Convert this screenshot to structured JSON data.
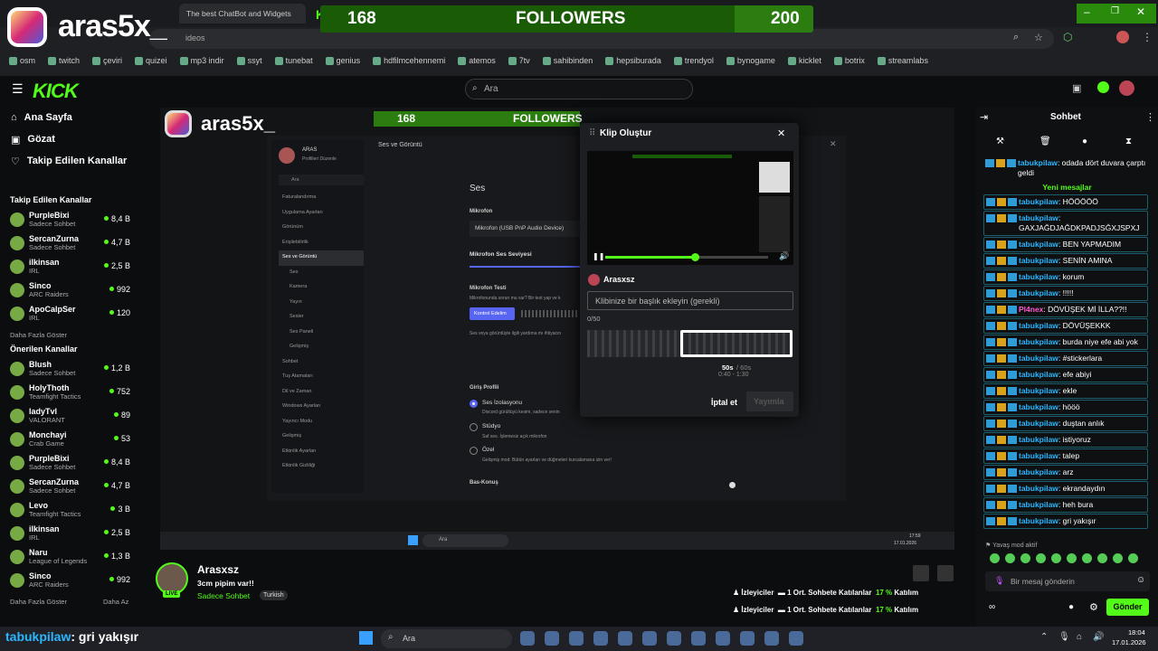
{
  "overlay": {
    "streamer_name": "aras5x_",
    "followers_current": "168",
    "followers_label": "FOLLOWERS",
    "followers_goal": "200",
    "follower_progress": 0.84
  },
  "browser": {
    "tab_title": "The best ChatBot and Widgets",
    "url_fragment": "ideos",
    "bookmarks": [
      "osm",
      "twitch",
      "çeviri",
      "quizei",
      "mp3 indir",
      "ssyt",
      "tunebat",
      "genius",
      "hdfilmcehennemi",
      "atemos",
      "7tv",
      "sahibinden",
      "hepsiburada",
      "trendyol",
      "bynogame",
      "kicklet",
      "botrix",
      "streamlabs"
    ]
  },
  "kick": {
    "logo": "KICK",
    "search_placeholder": "Ara"
  },
  "sidebar": {
    "nav": [
      {
        "label": "Ana Sayfa",
        "icon": "home-icon"
      },
      {
        "label": "Gözat",
        "icon": "browse-icon"
      },
      {
        "label": "Takip Edilen Kanallar",
        "icon": "heart-icon"
      }
    ],
    "followed_title": "Takip Edilen Kanallar",
    "followed": [
      {
        "name": "PurpleBixi",
        "cat": "Sadece Sohbet",
        "viewers": "8,4 B"
      },
      {
        "name": "SercanZurna",
        "cat": "Sadece Sohbet",
        "viewers": "4,7 B"
      },
      {
        "name": "ilkinsan",
        "cat": "IRL",
        "viewers": "2,5 B"
      },
      {
        "name": "Sinco",
        "cat": "ARC Raiders",
        "viewers": "992"
      },
      {
        "name": "ApoCalpSer",
        "cat": "IRL",
        "viewers": "120"
      }
    ],
    "followed_more": "Daha Fazla Göster",
    "recommended_title": "Önerilen Kanallar",
    "recommended": [
      {
        "name": "Blush",
        "cat": "Sadece Sohbet",
        "viewers": "1,2 B"
      },
      {
        "name": "HolyThoth",
        "cat": "Teamfight Tactics",
        "viewers": "752"
      },
      {
        "name": "ladyTvl",
        "cat": "VALORANT",
        "viewers": "89"
      },
      {
        "name": "Monchayi",
        "cat": "Crab Game",
        "viewers": "53"
      },
      {
        "name": "PurpleBixi",
        "cat": "Sadece Sohbet",
        "viewers": "8,4 B"
      },
      {
        "name": "SercanZurna",
        "cat": "Sadece Sohbet",
        "viewers": "4,7 B"
      },
      {
        "name": "Levo",
        "cat": "Teamfight Tactics",
        "viewers": "3 B"
      },
      {
        "name": "ilkinsan",
        "cat": "IRL",
        "viewers": "2,5 B"
      },
      {
        "name": "Naru",
        "cat": "League of Legends",
        "viewers": "1,3 B"
      },
      {
        "name": "Sinco",
        "cat": "ARC Raiders",
        "viewers": "992"
      }
    ],
    "rec_more": "Daha Fazla Göster",
    "rec_less": "Daha Az"
  },
  "settings": {
    "profile_name": "ARAS",
    "profile_sub": "Profilleri Düzenle",
    "search": "Ara",
    "menu": [
      "Faturalandırma",
      "Uygulama Ayarları",
      "Görünüm",
      "Erişilebilirlik",
      "Ses ve Görüntü",
      "Ses",
      "Kamera",
      "Yayın",
      "Sesler",
      "Ses Paneli",
      "Gelişmiş",
      "Sohbet",
      "Tuş Atamaları",
      "Dil ve Zaman",
      "Windows Ayarları",
      "Yayıncı Modu",
      "Gelişmiş",
      "Etkinlik Ayarları",
      "Etkinlik Gizliliği"
    ],
    "header": "Ses ve Görüntü",
    "section": "Ses",
    "mic_label": "Mikrofon",
    "mic_device": "Mikrofon (USB PnP Audio Device)",
    "tab": "Mikrofon Ses Seviyesi",
    "mic_test": "Mikrofon Testi",
    "mic_test_desc": "Mikrofonunda sorun mu var? Bir test yap ve k",
    "check_btn": "Kontrol Edelim",
    "help": "Ses veya görüntüyle ilgili yardıma mı ihtiyacın",
    "input_profile": "Giriş Profili",
    "opt1": "Ses İzolasyonu",
    "opt1_desc": "Discord gürültüyü kesim, sadece senin",
    "opt2": "Stüdyo",
    "opt2_desc": "Saf ses. İşlemesiz açık mikrofon",
    "opt3": "Özel",
    "opt3_desc": "Gelişmiş mod: Bütün ayarları ve düğmeleri kurcalamana izin ver!",
    "ptt": "Bas-Konuş",
    "clock": "17:59",
    "date": "17.01.2026"
  },
  "clip": {
    "title": "Klip Oluştur",
    "username": "Arasxsz",
    "input_placeholder": "Klibinize bir başlık ekleyin (gerekli)",
    "counter": "0/50",
    "duration_sel": "50s",
    "duration_max": "/ 60s",
    "range": "0:40 - 1:30",
    "cancel": "İptal et",
    "publish": "Yayımla",
    "playback": 0.55
  },
  "chat": {
    "title": "Sohbet",
    "pinned": {
      "user": "tabukpilaw",
      "text": "odada dört duvara çarptı geldi"
    },
    "new_label": "Yeni mesajlar",
    "messages": [
      {
        "user": "tabukpilaw",
        "text": "HÖÖÖÖÖ"
      },
      {
        "user": "tabukpilaw",
        "text": "GAXJAĞDJAĞDKPADJSĞXJSPXJ"
      },
      {
        "user": "tabukpilaw",
        "text": "BEN YAPMADIM"
      },
      {
        "user": "tabukpilaw",
        "text": "SENİN AMINA"
      },
      {
        "user": "tabukpilaw",
        "text": "korum"
      },
      {
        "user": "tabukpilaw",
        "text": "!!!!!"
      },
      {
        "user": "Pl4nex",
        "text": "DÖVÜŞEK Mİ İLLA??!!"
      },
      {
        "user": "tabukpilaw",
        "text": "DÖVÜŞEKKK"
      },
      {
        "user": "tabukpilaw",
        "text": "burda niye efe abi yok"
      },
      {
        "user": "tabukpilaw",
        "text": "#stickerlara"
      },
      {
        "user": "tabukpilaw",
        "text": "efe abiyi"
      },
      {
        "user": "tabukpilaw",
        "text": "ekle"
      },
      {
        "user": "tabukpilaw",
        "text": "hööö"
      },
      {
        "user": "tabukpilaw",
        "text": "duştan anlık"
      },
      {
        "user": "tabukpilaw",
        "text": "istiyoruz"
      },
      {
        "user": "tabukpilaw",
        "text": "talep"
      },
      {
        "user": "tabukpilaw",
        "text": "arz"
      },
      {
        "user": "tabukpilaw",
        "text": "ekrandaydın"
      },
      {
        "user": "tabukpilaw",
        "text": "heh bura"
      },
      {
        "user": "tabukpilaw",
        "text": "gri yakışır"
      }
    ],
    "slow_mode": "Yavaş mod aktif",
    "input_placeholder": "Bir mesaj gönderin",
    "send": "Gönder"
  },
  "stream": {
    "name": "Arasxsz",
    "title": "3cm pipim var!!",
    "category": "Sadece Sohbet",
    "tag": "Turkish",
    "live": "LIVE",
    "stats_viewers": "İzleyiciler",
    "stats_chat": "1 Ort. Sohbete Katılanlar",
    "stats_pct": "17 %",
    "stats_pct_label": "Katılım"
  },
  "ticker": {
    "user": "tabukpilaw",
    "text": ": gri yakışır"
  },
  "taskbar": {
    "search": "Ara",
    "clock": "18:04",
    "date": "17.01.2026"
  }
}
